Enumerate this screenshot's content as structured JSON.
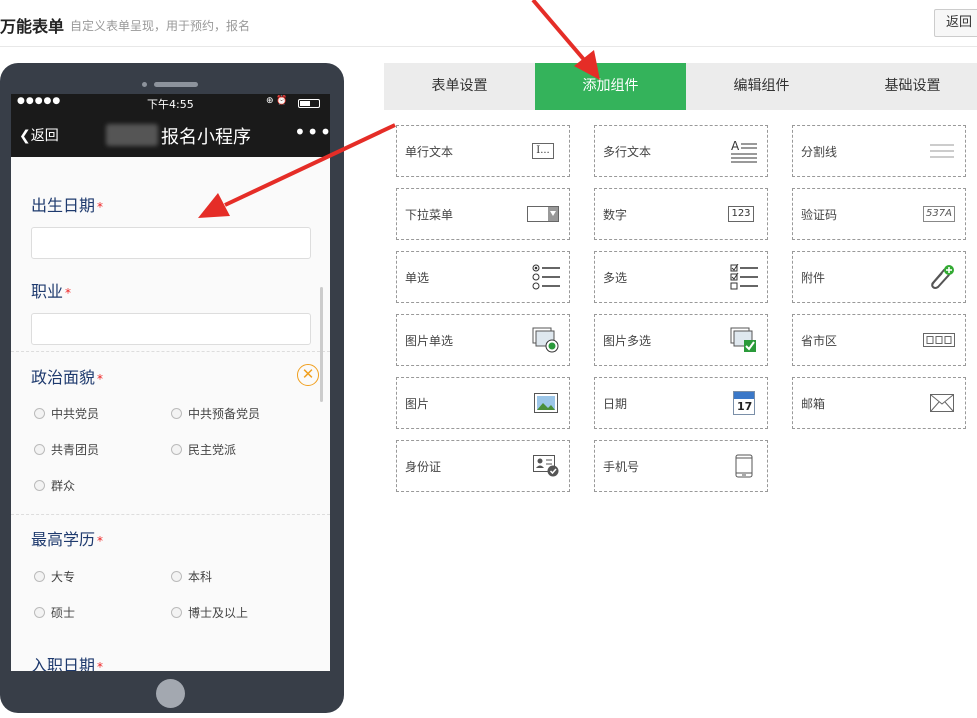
{
  "header": {
    "title": "万能表单",
    "subtitle": "自定义表单呈现，用于预约，报名",
    "back_label": "返回"
  },
  "phone": {
    "status": {
      "signal": "●●●●●",
      "time": "下午4:55"
    },
    "nav": {
      "back": "返回",
      "title": "报名小程序",
      "more": "•••"
    },
    "fields": {
      "birthdate": {
        "label": "出生日期",
        "required": "*"
      },
      "occupation": {
        "label": "职业",
        "required": "*"
      },
      "political": {
        "label": "政治面貌",
        "required": "*",
        "options": [
          "中共党员",
          "中共预备党员",
          "共青团员",
          "民主党派",
          "群众"
        ]
      },
      "education": {
        "label": "最高学历",
        "required": "*",
        "options": [
          "大专",
          "本科",
          "硕士",
          "博士及以上"
        ]
      },
      "hire_date": {
        "label": "入职日期",
        "required": "*"
      }
    }
  },
  "tabs": [
    {
      "label": "表单设置",
      "active": false
    },
    {
      "label": "添加组件",
      "active": true
    },
    {
      "label": "编辑组件",
      "active": false
    },
    {
      "label": "基础设置",
      "active": false
    }
  ],
  "components": [
    {
      "label": "单行文本",
      "icon": "text-input-icon"
    },
    {
      "label": "多行文本",
      "icon": "textarea-icon"
    },
    {
      "label": "分割线",
      "icon": "divider-icon"
    },
    {
      "label": "下拉菜单",
      "icon": "dropdown-icon"
    },
    {
      "label": "数字",
      "icon": "number-icon"
    },
    {
      "label": "验证码",
      "icon": "captcha-icon"
    },
    {
      "label": "单选",
      "icon": "radio-list-icon"
    },
    {
      "label": "多选",
      "icon": "checkbox-list-icon"
    },
    {
      "label": "附件",
      "icon": "attachment-icon"
    },
    {
      "label": "图片单选",
      "icon": "image-radio-icon"
    },
    {
      "label": "图片多选",
      "icon": "image-checkbox-icon"
    },
    {
      "label": "省市区",
      "icon": "region-icon"
    },
    {
      "label": "图片",
      "icon": "image-icon"
    },
    {
      "label": "日期",
      "icon": "calendar-icon"
    },
    {
      "label": "邮箱",
      "icon": "mail-icon"
    },
    {
      "label": "身份证",
      "icon": "id-card-icon"
    },
    {
      "label": "手机号",
      "icon": "phone-icon"
    }
  ],
  "icon_text": {
    "text_input": "I...",
    "number": "123",
    "captcha": "537A",
    "calendar_day": "17"
  },
  "colors": {
    "accent": "#34b35b",
    "arrow": "#e52d27",
    "label": "#1e3a6e",
    "required": "#ee2222"
  }
}
